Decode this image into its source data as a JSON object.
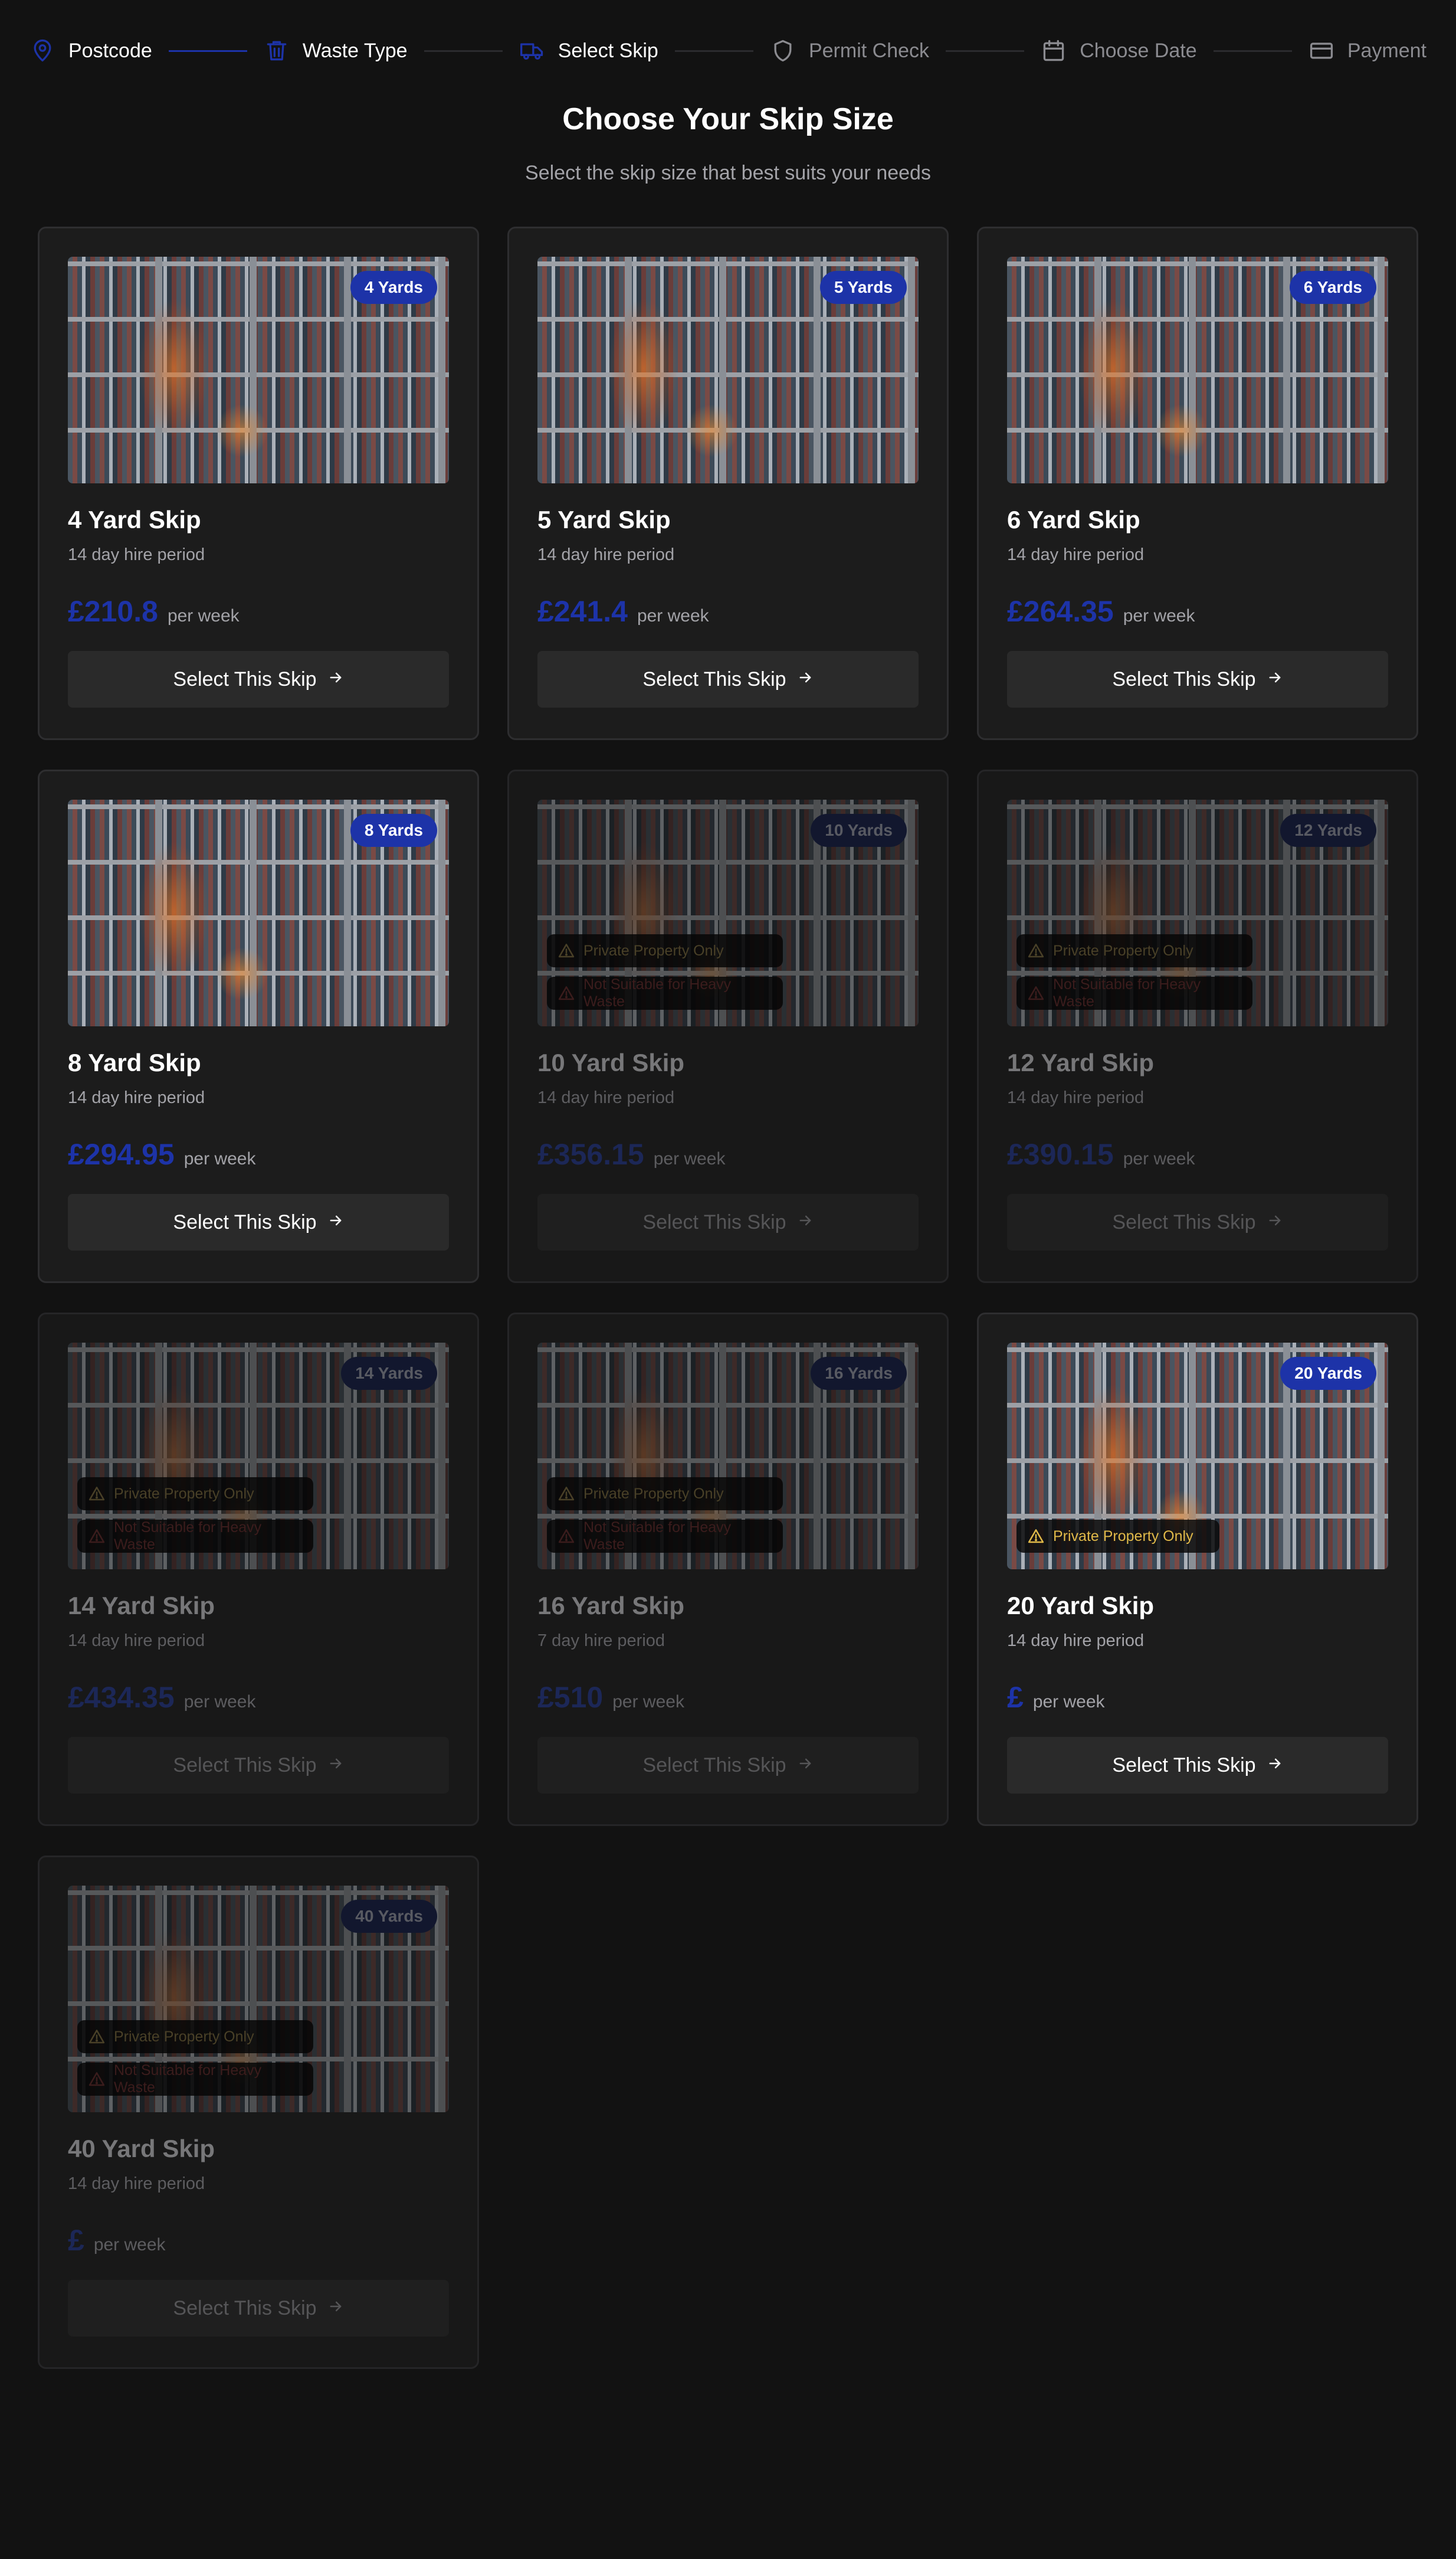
{
  "stepper": {
    "steps": [
      {
        "label": "Postcode",
        "icon": "map-pin-icon",
        "state": "done"
      },
      {
        "label": "Waste Type",
        "icon": "trash-icon",
        "state": "done"
      },
      {
        "label": "Select Skip",
        "icon": "truck-icon",
        "state": "current"
      },
      {
        "label": "Permit Check",
        "icon": "shield-icon",
        "state": "pending"
      },
      {
        "label": "Choose Date",
        "icon": "calendar-icon",
        "state": "pending"
      },
      {
        "label": "Payment",
        "icon": "credit-card-icon",
        "state": "pending"
      }
    ]
  },
  "header": {
    "title": "Choose Your Skip Size",
    "subtitle": "Select the skip size that best suits your needs"
  },
  "labels": {
    "per_week": "per week",
    "select_button": "Select This Skip",
    "warning_private": "Private Property Only",
    "warning_heavy": "Not Suitable for Heavy Waste"
  },
  "skips": [
    {
      "badge": "4 Yards",
      "title": "4 Yard Skip",
      "hire": "14 day hire period",
      "price": "£210.8",
      "disabled": false,
      "private_only": false,
      "heavy_unsuitable": false
    },
    {
      "badge": "5 Yards",
      "title": "5 Yard Skip",
      "hire": "14 day hire period",
      "price": "£241.4",
      "disabled": false,
      "private_only": false,
      "heavy_unsuitable": false
    },
    {
      "badge": "6 Yards",
      "title": "6 Yard Skip",
      "hire": "14 day hire period",
      "price": "£264.35",
      "disabled": false,
      "private_only": false,
      "heavy_unsuitable": false
    },
    {
      "badge": "8 Yards",
      "title": "8 Yard Skip",
      "hire": "14 day hire period",
      "price": "£294.95",
      "disabled": false,
      "private_only": false,
      "heavy_unsuitable": false
    },
    {
      "badge": "10 Yards",
      "title": "10 Yard Skip",
      "hire": "14 day hire period",
      "price": "£356.15",
      "disabled": true,
      "private_only": true,
      "heavy_unsuitable": true
    },
    {
      "badge": "12 Yards",
      "title": "12 Yard Skip",
      "hire": "14 day hire period",
      "price": "£390.15",
      "disabled": true,
      "private_only": true,
      "heavy_unsuitable": true
    },
    {
      "badge": "14 Yards",
      "title": "14 Yard Skip",
      "hire": "14 day hire period",
      "price": "£434.35",
      "disabled": true,
      "private_only": true,
      "heavy_unsuitable": true
    },
    {
      "badge": "16 Yards",
      "title": "16 Yard Skip",
      "hire": "7 day hire period",
      "price": "£510",
      "disabled": true,
      "private_only": true,
      "heavy_unsuitable": true
    },
    {
      "badge": "20 Yards",
      "title": "20 Yard Skip",
      "hire": "14 day hire period",
      "price": "£",
      "disabled": false,
      "private_only": true,
      "heavy_unsuitable": false
    },
    {
      "badge": "40 Yards",
      "title": "40 Yard Skip",
      "hire": "14 day hire period",
      "price": "£",
      "disabled": true,
      "private_only": true,
      "heavy_unsuitable": true
    }
  ],
  "colors": {
    "background": "#121212",
    "card": "#1c1c1c",
    "accent": "#1d33a8",
    "warning_private": "#e0b949",
    "warning_heavy": "#c74242",
    "muted_text": "#a3a3a8"
  }
}
